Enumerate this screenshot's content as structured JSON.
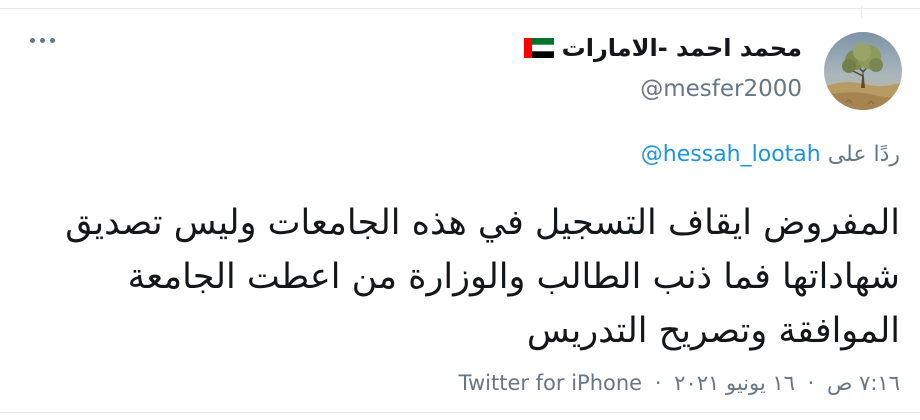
{
  "tweet": {
    "display_name": "محمد احمد -الامارات",
    "handle": "@mesfer2000",
    "flag_icon": "uae-flag-icon",
    "more_icon": "more-horizontal-icon",
    "reply": {
      "prefix": "ردًا على",
      "mention": "@hessah_lootah"
    },
    "text": "المفروض ايقاف التسجيل في هذه الجامعات وليس تصديق شهاداتها فما ذنب الطالب والوزارة من اعطت الجامعة الموافقة وتصريح التدريس",
    "time": "٧:١٦ ص",
    "date": "١٦ يونيو ٢٠٢١",
    "source": "Twitter for iPhone",
    "separator": "·"
  },
  "colors": {
    "text": "#14171a",
    "secondary": "#657786",
    "link": "#1b95e0",
    "border": "#e6ecf0",
    "flag_green": "#00732f",
    "flag_white": "#ffffff",
    "flag_black": "#000000",
    "flag_red": "#ff0000"
  }
}
